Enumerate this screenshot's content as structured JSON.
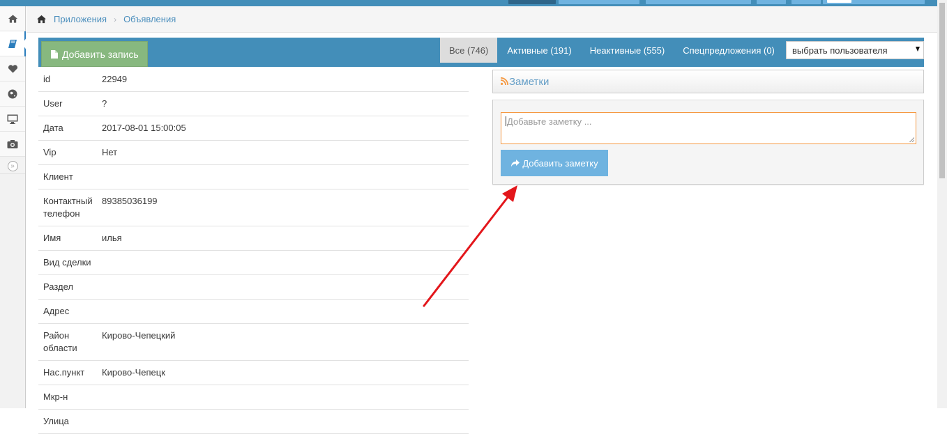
{
  "breadcrumbs": {
    "items": [
      "Приложения",
      "Объявления"
    ]
  },
  "toolbar": {
    "add_record_label": "Добавить запись",
    "tabs": [
      "Все (746)",
      "Активные (191)",
      "Неактивные (555)",
      "Спецпредложения (0)"
    ],
    "user_select": "выбрать пользователя"
  },
  "record": [
    {
      "key": "id",
      "value": "22949"
    },
    {
      "key": "User",
      "value": "?"
    },
    {
      "key": "Дата",
      "value": "2017-08-01 15:00:05"
    },
    {
      "key": "Vip",
      "value": "Нет"
    },
    {
      "key": "Клиент",
      "value": ""
    },
    {
      "key": "Контактный телефон",
      "value": "89385036199"
    },
    {
      "key": "Имя",
      "value": "илья"
    },
    {
      "key": "Вид сделки",
      "value": ""
    },
    {
      "key": "Раздел",
      "value": ""
    },
    {
      "key": "Адрес",
      "value": ""
    },
    {
      "key": "Район области",
      "value": "Кирово-Чепецкий"
    },
    {
      "key": "Нас.пункт",
      "value": "Кирово-Чепецк"
    },
    {
      "key": "Мкр-н",
      "value": ""
    },
    {
      "key": "Улица",
      "value": ""
    }
  ],
  "notes": {
    "title": "Заметки",
    "placeholder": "Добавьте заметку ...",
    "add_button": "Добавить заметку"
  },
  "sidebar": {
    "icons": [
      "home-icon",
      "book-icon",
      "heart-icon",
      "globe-icon",
      "desktop-icon",
      "camera-icon"
    ]
  },
  "colors": {
    "primary_blue": "#438eb9",
    "green_button": "#87b87f",
    "light_blue_button": "#6fb3e0",
    "annotation_arrow": "#e3161b"
  }
}
